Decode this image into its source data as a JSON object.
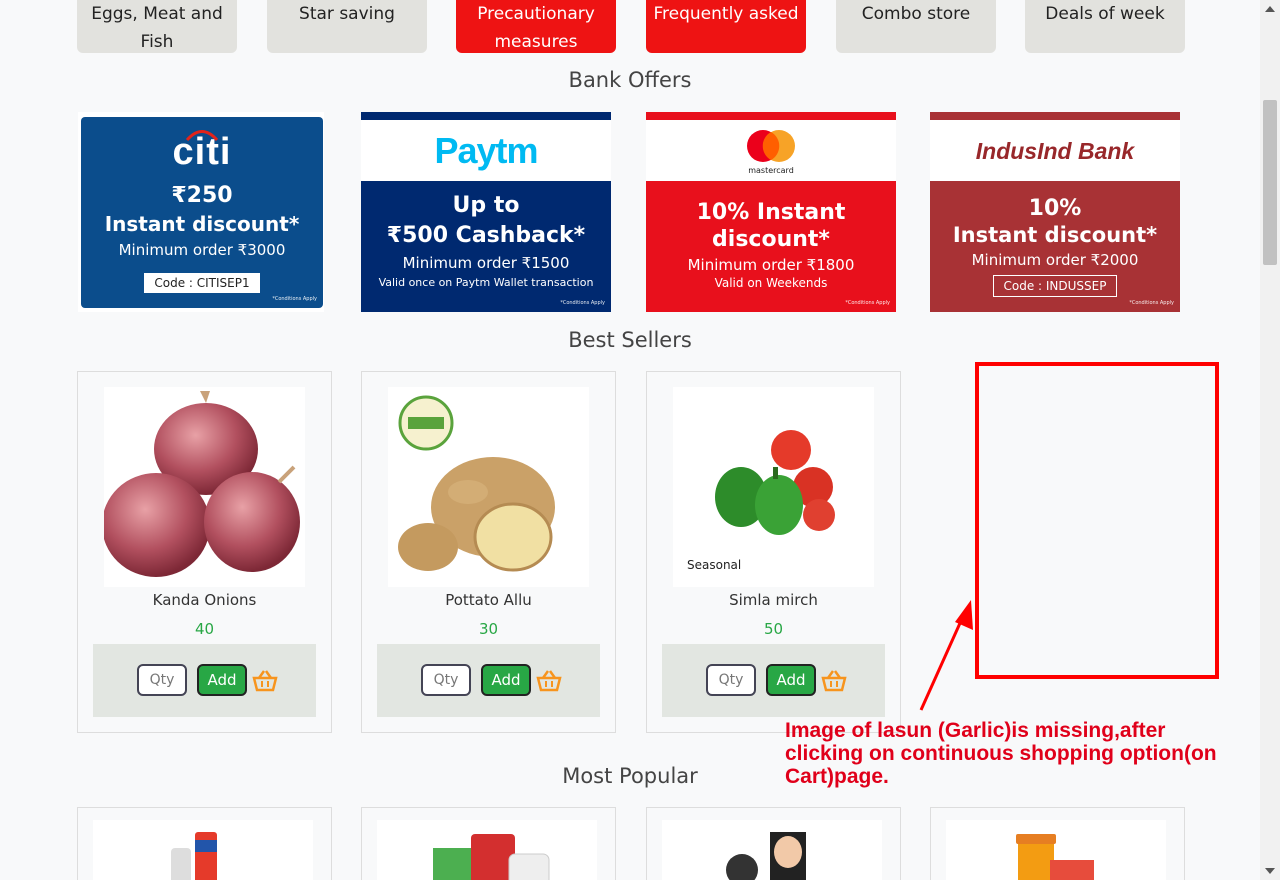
{
  "categories": [
    {
      "label": "Eggs, Meat and Fish",
      "lines": [
        "Eggs, Meat and",
        "Fish"
      ],
      "style": "grey"
    },
    {
      "label": "Star saving",
      "lines": [
        "Star saving"
      ],
      "style": "grey"
    },
    {
      "label": "Precautionary measures",
      "lines": [
        "Precautionary",
        "measures"
      ],
      "style": "red"
    },
    {
      "label": "Frequently asked",
      "lines": [
        "Frequently asked"
      ],
      "style": "red"
    },
    {
      "label": "Combo store",
      "lines": [
        "Combo store"
      ],
      "style": "grey"
    },
    {
      "label": "Deals of week",
      "lines": [
        "Deals of week"
      ],
      "style": "grey"
    }
  ],
  "bank_offers_title": "Bank Offers",
  "bank_offers": [
    {
      "brand": "citi",
      "amount": "₹250",
      "headline": "Instant discount*",
      "min_order": "Minimum order ₹3000",
      "code": "Code : CITISEP1",
      "note": "*Conditions Apply",
      "color": "#0b4d8c"
    },
    {
      "brand": "Paytm",
      "headline1": "Up to",
      "headline2": "₹500 Cashback*",
      "min_order": "Minimum order ₹1500",
      "extra": "Valid once on Paytm Wallet transaction",
      "note": "*Conditions Apply",
      "color": "#002970"
    },
    {
      "brand": "mastercard",
      "headline1": "10% Instant",
      "headline2": "discount*",
      "min_order": "Minimum order ₹1800",
      "extra": "Valid on Weekends",
      "note": "*Conditions Apply",
      "color": "#e8101c"
    },
    {
      "brand": "IndusInd Bank",
      "headline1": "10%",
      "headline2": "Instant discount*",
      "min_order": "Minimum order ₹2000",
      "code": "Code : INDUSSEP",
      "note": "*Conditions Apply",
      "color": "#a83235"
    }
  ],
  "best_sellers_title": "Best Sellers",
  "best_sellers": [
    {
      "name": "Kanda Onions",
      "price": "40",
      "image": "onion-image"
    },
    {
      "name": "Pottato Allu",
      "price": "30",
      "image": "potato-image"
    },
    {
      "name": "Simla mirch",
      "price": "50",
      "image": "capsicum-image",
      "image_caption": "Seasonal"
    }
  ],
  "qty_placeholder": "Qty",
  "add_label": "Add",
  "most_popular_title": "Most Popular",
  "annotation": {
    "text": "Image of lasun (Garlic)is missing,after clicking on continuous shopping option(on Cart)page.",
    "lines": [
      "Image of lasun (Garlic)is missing,after",
      "clicking on continuous shopping option(on",
      "Cart)page."
    ],
    "color": "#e0001a"
  },
  "colors": {
    "accent_red": "#ee1313",
    "add_green": "#28a745",
    "price_green": "#28a745",
    "basket_orange": "#f7941d"
  }
}
